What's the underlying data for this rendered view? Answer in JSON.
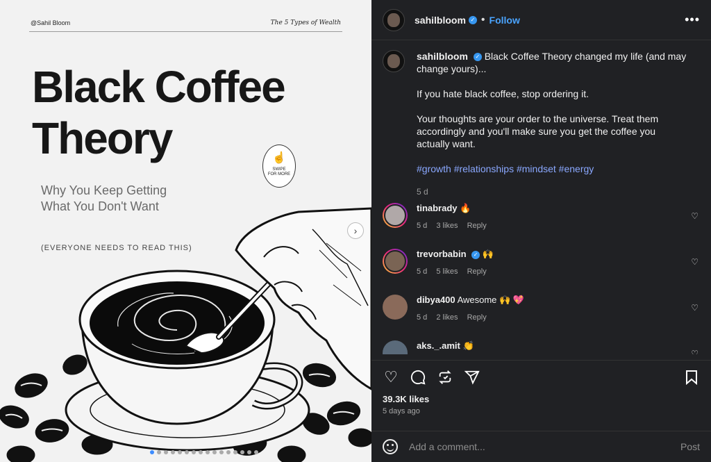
{
  "slide": {
    "handle": "@Sahil Bloom",
    "series": "The 5 Types of Wealth",
    "title_line1": "Black Coffee",
    "title_line2": "Theory",
    "sub_line1": "Why You Keep Getting",
    "sub_line2": "What You Don't Want",
    "caps": "(EVERYONE NEEDS TO READ THIS)",
    "swipe_line1": "SWIPE",
    "swipe_line2": "FOR MORE",
    "next_icon": "chevron-right-icon",
    "dots": [
      true,
      false,
      false,
      false,
      false,
      false,
      false,
      false,
      false,
      false,
      false,
      false,
      false,
      false,
      false,
      false
    ]
  },
  "header": {
    "username": "sahilbloom",
    "verified": true,
    "follow": "Follow",
    "more_icon": "more-icon"
  },
  "caption": {
    "username": "sahilbloom",
    "para1": "Black Coffee Theory changed my life (and may change yours)...",
    "para2": "If you hate black coffee, stop ordering it.",
    "para3": "Your thoughts are your order to the universe. Treat them accordingly and you'll make sure you get the coffee you actually want.",
    "tags": "#growth #relationships #mindset #energy",
    "age": "5 d"
  },
  "comments": [
    {
      "user": "tinabrady",
      "text": "🔥",
      "age": "5 d",
      "likes": "3 likes",
      "reply": "Reply",
      "color": "#a8a8a8"
    },
    {
      "user": "trevorbabin",
      "text": "🙌",
      "age": "5 d",
      "likes": "5 likes",
      "reply": "Reply",
      "color": "#7a6454"
    },
    {
      "user": "dibya400",
      "text": "Awesome 🙌 💖",
      "age": "5 d",
      "likes": "2 likes",
      "reply": "Reply",
      "color": "#8a6a5a"
    },
    {
      "user": "aks._.amit",
      "text": "👏",
      "age": "",
      "likes": "",
      "reply": "",
      "color": "#5a6a7a"
    }
  ],
  "stats": {
    "likes": "39.3K likes",
    "ago": "5 days ago"
  },
  "add_comment": {
    "placeholder": "Add a comment...",
    "post": "Post"
  }
}
